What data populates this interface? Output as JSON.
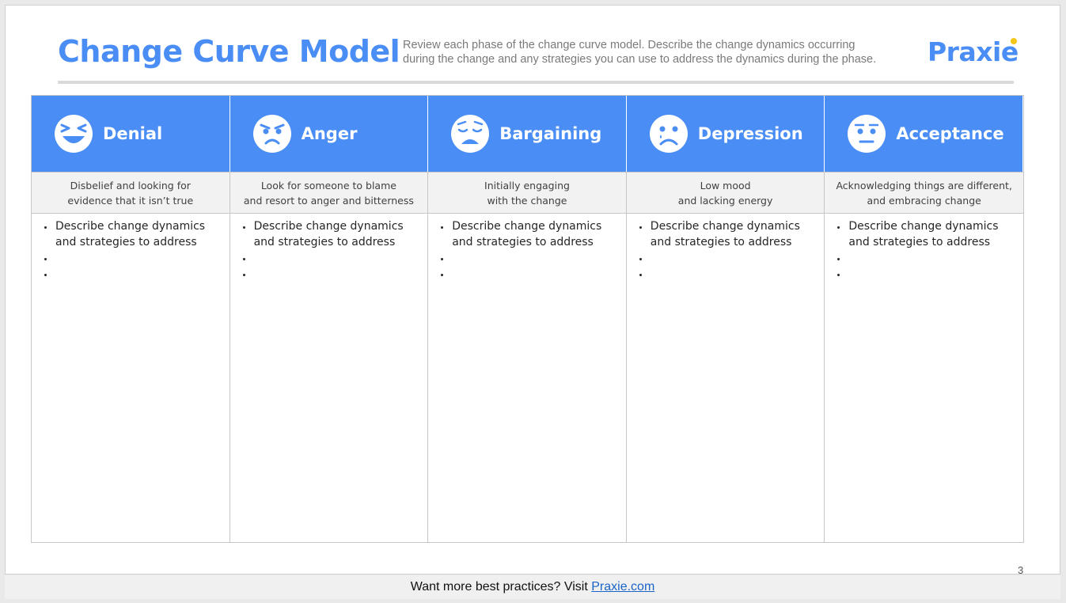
{
  "header": {
    "title": "Change Curve Model",
    "subtitle_line1": "Review each phase of the change curve model. Describe the change dynamics occurring",
    "subtitle_line2": "during the change and any strategies you can use to address the dynamics during the phase.",
    "logo": "Praxie"
  },
  "colors": {
    "accent": "#4a8ef5",
    "logo_dot": "#f5c518",
    "desc_bg": "#f2f2f2"
  },
  "phases": [
    {
      "name": "Denial",
      "icon": "laughing-face-icon",
      "desc_line1": "Disbelief and looking for",
      "desc_line2": "evidence that it isn’t true",
      "bullets": [
        "Describe change dynamics and strategies to address",
        "",
        ""
      ]
    },
    {
      "name": "Anger",
      "icon": "angry-face-icon",
      "desc_line1": "Look for someone to blame",
      "desc_line2": "and resort to anger and bitterness",
      "bullets": [
        "Describe change dynamics and strategies to address",
        "",
        ""
      ]
    },
    {
      "name": "Bargaining",
      "icon": "weary-face-icon",
      "desc_line1": "Initially engaging",
      "desc_line2": "with the change",
      "bullets": [
        "Describe change dynamics and strategies to address",
        "",
        ""
      ]
    },
    {
      "name": "Depression",
      "icon": "crying-face-icon",
      "desc_line1": "Low mood",
      "desc_line2": "and lacking energy",
      "bullets": [
        "Describe change dynamics and strategies to address",
        "",
        ""
      ]
    },
    {
      "name": "Acceptance",
      "icon": "neutral-face-icon",
      "desc_line1": "Acknowledging things are different,",
      "desc_line2": "and embracing change",
      "bullets": [
        "Describe change dynamics and strategies to address",
        "",
        ""
      ]
    }
  ],
  "page_number": "3",
  "footer": {
    "text": "Want more best practices? Visit ",
    "link": "Praxie.com"
  }
}
